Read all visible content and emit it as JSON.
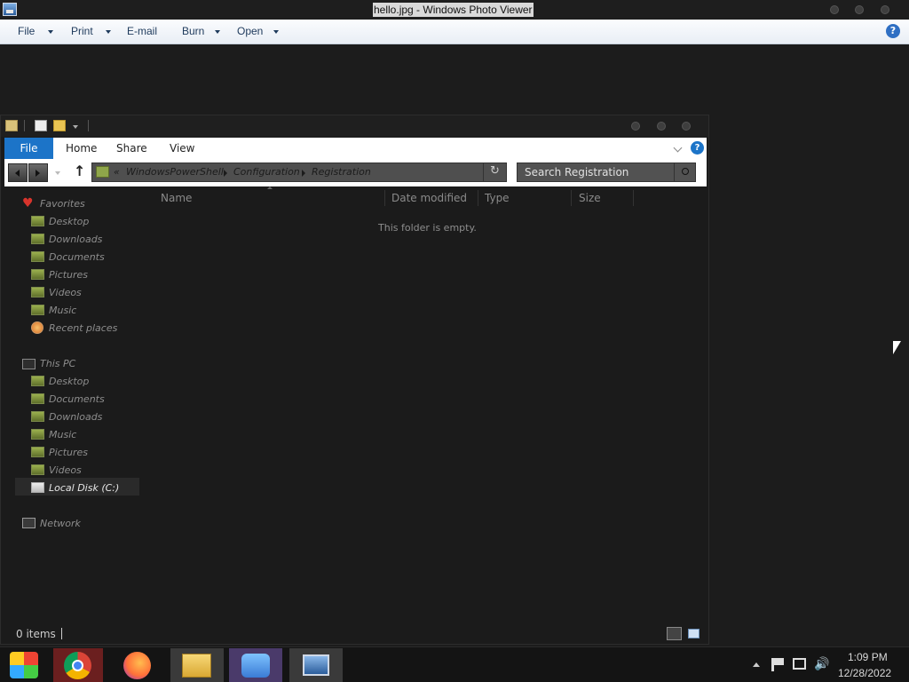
{
  "photo_viewer": {
    "title": "hello.jpg - Windows Photo Viewer",
    "menu": [
      {
        "label": "File",
        "has_dropdown": true
      },
      {
        "label": "Print",
        "has_dropdown": true
      },
      {
        "label": "E-mail",
        "has_dropdown": false
      },
      {
        "label": "Burn",
        "has_dropdown": true
      },
      {
        "label": "Open",
        "has_dropdown": true
      }
    ],
    "help_icon": "?"
  },
  "explorer": {
    "ribbon_tabs": [
      "File",
      "Home",
      "Share",
      "View"
    ],
    "address": {
      "prefix": "«",
      "crumbs": [
        "WindowsPowerShell",
        "Configuration",
        "Registration"
      ]
    },
    "search": {
      "placeholder": "Search Registration"
    },
    "columns": [
      "Name",
      "Date modified",
      "Type",
      "Size"
    ],
    "empty_message": "This folder is empty.",
    "nav": {
      "favorites_label": "Favorites",
      "favorites": [
        "Desktop",
        "Downloads",
        "Documents",
        "Pictures",
        "Videos",
        "Music",
        "Recent places"
      ],
      "this_pc_label": "This PC",
      "this_pc": [
        "Desktop",
        "Documents",
        "Downloads",
        "Music",
        "Pictures",
        "Videos",
        "Local Disk (C:)"
      ],
      "network_label": "Network"
    },
    "status": {
      "items": "0 items"
    }
  },
  "taskbar": {
    "apps": [
      "start-orb-icon",
      "chrome-icon",
      "firefox-icon",
      "file-explorer-icon",
      "messenger-icon",
      "photo-viewer-icon"
    ],
    "clock": {
      "time": "1:09 PM",
      "date": "12/28/2022"
    }
  },
  "colors": {
    "ribbon_file": "#1c74c8",
    "window_bg": "#1b1b1b",
    "taskbar_bg": "#141414"
  }
}
